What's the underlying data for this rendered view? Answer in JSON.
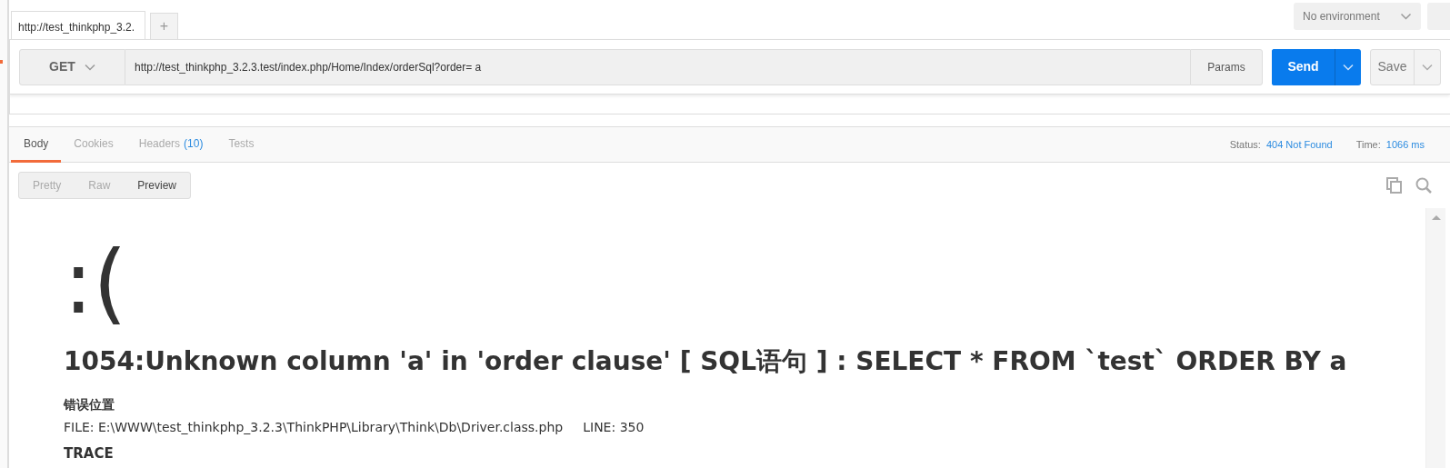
{
  "tabs": [
    {
      "label": "http://test_thinkphp_3.2.",
      "selected": true
    }
  ],
  "new_tab_button": "+",
  "environment": "No environment",
  "request": {
    "method": "GET",
    "url": "http://test_thinkphp_3.2.3.test/index.php/Home/Index/orderSql?order= a",
    "params_button": "Params",
    "send_button": "Send",
    "save_button": "Save"
  },
  "response_tabs": [
    {
      "label": "Body",
      "selected": true
    },
    {
      "label": "Cookies",
      "selected": false
    },
    {
      "label": "Headers",
      "count": "(10)",
      "selected": false
    },
    {
      "label": "Tests",
      "selected": false
    }
  ],
  "status": {
    "label": "Status:",
    "value": "404 Not Found"
  },
  "time": {
    "label": "Time:",
    "value": "1066 ms"
  },
  "view_modes": [
    {
      "label": "Pretty",
      "selected": false
    },
    {
      "label": "Raw",
      "selected": false
    },
    {
      "label": "Preview",
      "selected": true
    }
  ],
  "preview": {
    "face": ":(",
    "heading": "1054:Unknown column 'a' in 'order clause' [ SQL语句 ] : SELECT * FROM `test` ORDER BY a",
    "location_title": "错误位置",
    "file": "FILE: E:\\WWW\\test_thinkphp_3.2.3\\ThinkPHP\\Library\\Think\\Db\\Driver.class.php",
    "line": "LINE: 350",
    "trace": "TRACE"
  }
}
